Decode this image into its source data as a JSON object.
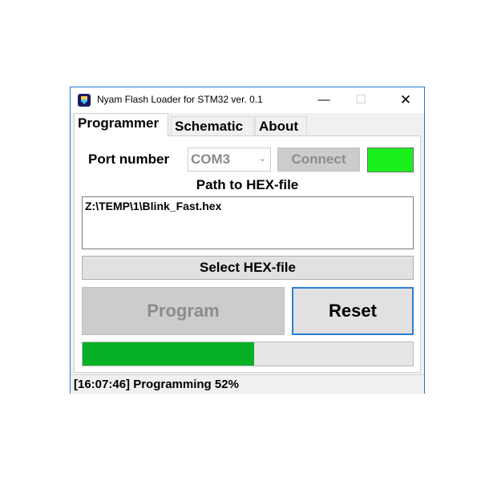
{
  "window": {
    "title": "Nyam Flash Loader for STM32 ver. 0.1",
    "controls": {
      "minimize": "—",
      "maximize": "☐",
      "close": "✕"
    }
  },
  "tabs": [
    {
      "label": "Programmer",
      "active": true
    },
    {
      "label": "Schematic",
      "active": false
    },
    {
      "label": "About",
      "active": false
    }
  ],
  "programmer": {
    "port_label": "Port number",
    "port_selected": "COM3",
    "port_arrow": "⌄",
    "connect_label": "Connect",
    "status_color": "#1cf01c",
    "path_label": "Path to HEX-file",
    "path_value": "Z:\\TEMP\\1\\Blink_Fast.hex",
    "select_hex_label": "Select HEX-file",
    "program_label": "Program",
    "reset_label": "Reset",
    "progress_percent": 52
  },
  "statusbar": {
    "text": "[16:07:46] Programming 52%"
  },
  "colors": {
    "accent_border": "#2b7ed6",
    "progress": "#06b025",
    "indicator": "#1cf01c"
  }
}
